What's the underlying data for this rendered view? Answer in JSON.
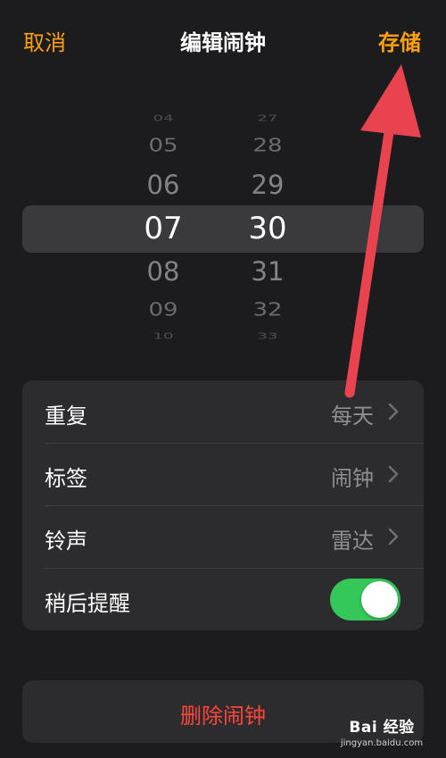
{
  "nav": {
    "cancel_label": "取消",
    "title": "编辑闹钟",
    "save_label": "存储"
  },
  "picker": {
    "hours": [
      "04",
      "05",
      "06",
      "07",
      "08",
      "09",
      "10"
    ],
    "minutes": [
      "27",
      "28",
      "29",
      "30",
      "31",
      "32",
      "33"
    ],
    "selected_hour": "07",
    "selected_minute": "30"
  },
  "settings": {
    "repeat": {
      "label": "重复",
      "value": "每天"
    },
    "label": {
      "label": "标签",
      "value": "闹钟"
    },
    "sound": {
      "label": "铃声",
      "value": "雷达"
    },
    "snooze": {
      "label": "稍后提醒",
      "enabled": true
    }
  },
  "delete": {
    "label": "删除闹钟"
  },
  "watermark": {
    "logo": "Bai  经验",
    "url": "jingyan.baidu.com"
  },
  "colors": {
    "background": "#1c1c1e",
    "accent": "#ff9f0a",
    "toggle_on": "#34c759",
    "destructive": "#ff453a",
    "annotation_arrow": "#e8434f"
  }
}
